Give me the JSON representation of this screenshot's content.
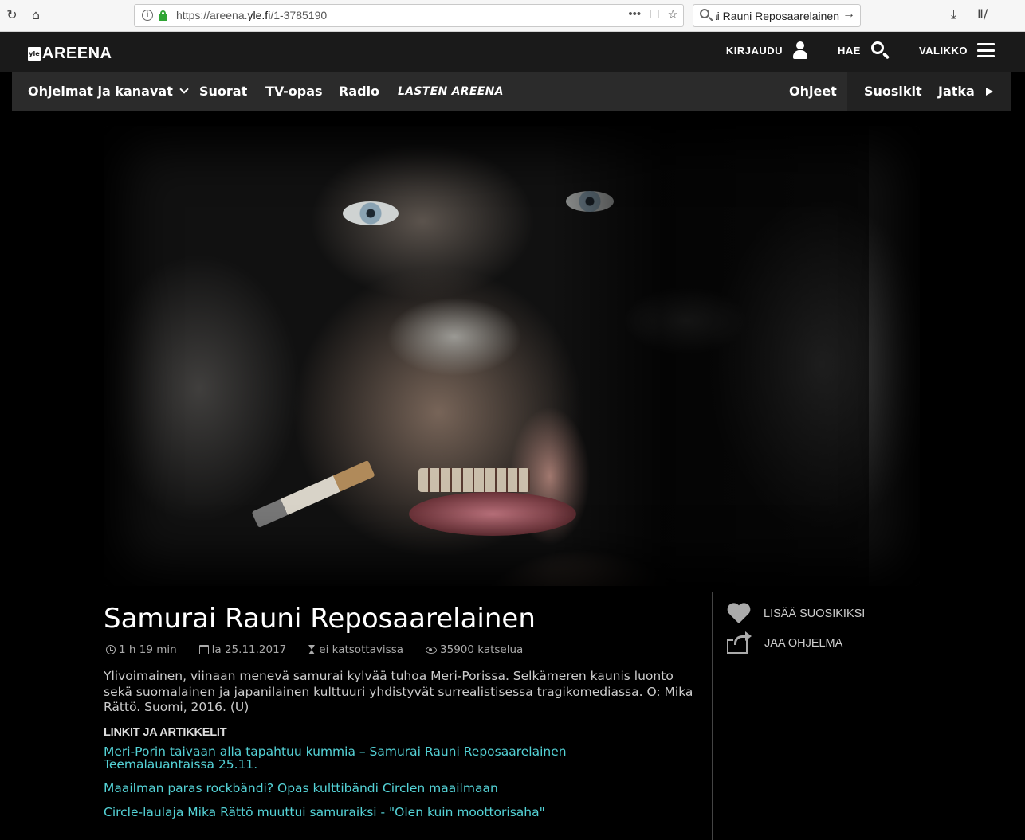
{
  "browser": {
    "url_prefix": "https://areena.",
    "url_domain": "yle.fi",
    "url_path": "/1-3785190",
    "search_query": "Samurai Rauni Reposaarelainen",
    "icons": [
      "reload-icon",
      "home-icon",
      "info-icon",
      "lock-icon",
      "more-icon",
      "pocket-icon",
      "bookmark-star-icon",
      "search-icon",
      "go-arrow-icon",
      "download-icon",
      "library-icon"
    ]
  },
  "header": {
    "logo_badge": "yle",
    "logo_text": "AREENA",
    "login_label": "KIRJAUDU",
    "search_label": "HAE",
    "menu_label": "VALIKKO"
  },
  "subnav": {
    "programs": "Ohjelmat ja kanavat",
    "live": "Suorat",
    "tvguide": "TV-opas",
    "radio": "Radio",
    "kids": "LASTEN AREENA",
    "help": "Ohjeet",
    "favorites": "Suosikit",
    "continue": "Jatka"
  },
  "program": {
    "title": "Samurai Rauni Reposaarelainen",
    "duration": "1 h 19 min",
    "date": "la 25.11.2017",
    "availability": "ei katsottavissa",
    "views": "35900 katselua",
    "description": "Ylivoimainen, viinaan menevä samurai kylvää tuhoa Meri-Porissa. Selkämeren kaunis luonto sekä suomalainen ja japanilainen kulttuuri yhdistyvät surrealistisessa tragikomediassa. O: Mika Rättö. Suomi, 2016. (U)",
    "links_heading": "LINKIT JA ARTIKKELIT",
    "links": [
      "Meri-Porin taivaan alla tapahtuu kummia – Samurai Rauni Reposaarelainen Teemalauantaissa 25.11.",
      "Maailman paras rockbändi? Opas kulttibändi Circlen maailmaan",
      "Circle-laulaja Mika Rättö muuttui samuraiksi - \"Olen kuin moottorisaha\""
    ]
  },
  "actions": {
    "add_favorite": "LISÄÄ SUOSIKIKSI",
    "share": "JAA OHJELMA"
  },
  "colors": {
    "background": "#000000",
    "topbar": "#1a1a1a",
    "subnav": "#2b2b2b",
    "link": "#54d2d6",
    "secure_lock": "#2fa534"
  }
}
